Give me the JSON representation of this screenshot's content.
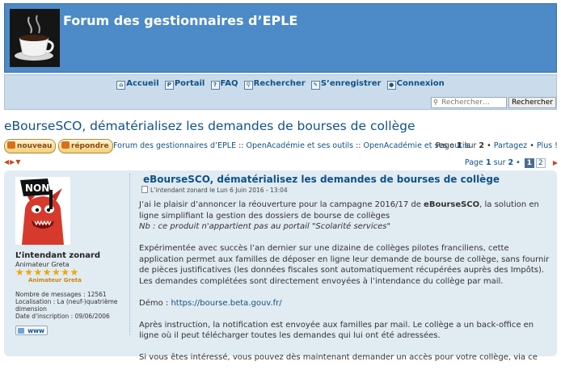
{
  "header": {
    "site_title": "Forum des gestionnaires d’EPLE",
    "logo_icon": "coffee-cup-icon"
  },
  "nav": {
    "items": [
      {
        "label": "Accueil",
        "icon": "home-icon"
      },
      {
        "label": "Portail",
        "icon": "portal-icon"
      },
      {
        "label": "FAQ",
        "icon": "faq-icon"
      },
      {
        "label": "Rechercher",
        "icon": "search-icon"
      },
      {
        "label": "S’enregistrer",
        "icon": "register-icon"
      },
      {
        "label": "Connexion",
        "icon": "login-icon"
      }
    ]
  },
  "search": {
    "placeholder": "Rechercher…",
    "button_label": "Rechercher"
  },
  "topic": {
    "title": "eBourseSCO, dématérialisez les demandes de bourses de collège"
  },
  "actions": {
    "new_label": "nouveau",
    "reply_label": "répondre"
  },
  "breadcrumbs": {
    "items": [
      "Forum des gestionnaires d’EPLE",
      "OpenAcadémie et ses outils",
      "OpenAcadémie et ses outils"
    ],
    "separator": "::"
  },
  "pagination": {
    "page_word": "Page",
    "current": "1",
    "of_word": "sur",
    "total": "2",
    "share_label": "Partagez",
    "more_label": "Plus !",
    "pages": [
      "1",
      "2"
    ]
  },
  "post": {
    "title": "eBourseSCO, dématérialisez les demandes de bourses de collège",
    "meta": "L’intendant zonard le Lun 6 Juin 2016 - 13:04",
    "author": {
      "username": "L’intendant zonard",
      "rank": "Animateur Greta",
      "stars": "★★★★★★★",
      "rank_label": "Animateur Greta",
      "message_count": "Nombre de messages : 12561",
      "location_line1": "Localisation : La (neuf-)quatrième",
      "location_line2": "dimension",
      "signup_date": "Date d'inscription : 09/06/2006",
      "website_label": "www",
      "avatar_text": "NON!"
    },
    "paragraphs": {
      "p1a": "J’ai le plaisir d’annoncer la réouverture pour la campagne 2016/17 de ",
      "p1b": "eBourseSCO",
      "p1c": ", la solution en ligne simplifiant la gestion des dossiers de bourse de collèges",
      "p1_note": "Nb : ce produit n'appartient pas au portail \"Scolarité services\"",
      "p2": "Expérimentée avec succès l’an dernier sur une dizaine de collèges pilotes franciliens, cette application permet aux familles de déposer en ligne leur demande de bourse de collège, sans fournir de pièces justificatives (les données fiscales sont automatiquement récupérées auprès des Impôts). Les demandes complétées sont directement envoyées à l’intendance du collège par mail.",
      "p3_prefix": "Démo : ",
      "p3_link": "https://bourse.beta.gouv.fr/",
      "p4": "Après instruction, la notification est envoyée aux familles par mail. Le collège a un back-office en ligne où il peut télécharger toutes les demandes qui lui ont été adressées.",
      "p5": "Si vous êtes intéressé, vous pouvez dès maintenant demander un accès pour votre collège, via ce"
    }
  },
  "colors": {
    "header_bg": "#4c8ac8",
    "nav_bg": "#cadceb",
    "post_bg": "#e1ebf2",
    "link": "#105289",
    "button_orange": "#f3cf7a"
  }
}
